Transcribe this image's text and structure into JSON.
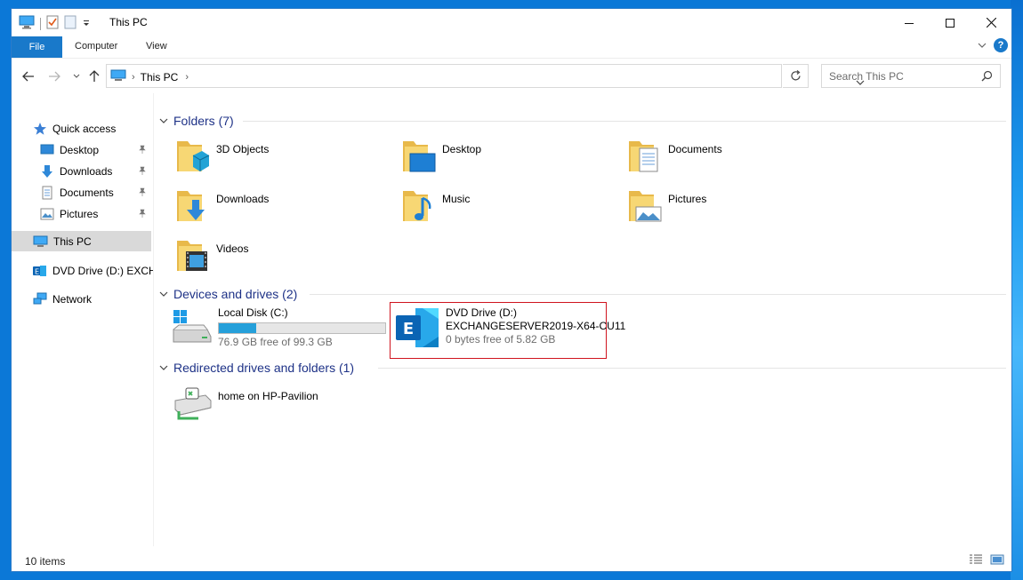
{
  "window": {
    "title": "This PC"
  },
  "ribbon": {
    "file_tab": "File",
    "tabs": [
      "Computer",
      "View"
    ],
    "help": "?"
  },
  "address_bar": {
    "crumbs": [
      "This PC"
    ]
  },
  "search": {
    "placeholder": "Search This PC"
  },
  "sidebar": {
    "items": [
      {
        "label": "Quick access",
        "icon": "star-icon"
      },
      {
        "label": "Desktop",
        "icon": "desktop-icon",
        "pinned": true
      },
      {
        "label": "Downloads",
        "icon": "download-arrow-icon",
        "pinned": true
      },
      {
        "label": "Documents",
        "icon": "document-icon",
        "pinned": true
      },
      {
        "label": "Pictures",
        "icon": "picture-icon",
        "pinned": true
      },
      {
        "label": "This PC",
        "icon": "computer-icon",
        "selected": true
      },
      {
        "label": "DVD Drive (D:) EXCHA",
        "icon": "exchange-icon"
      },
      {
        "label": "Network",
        "icon": "network-icon"
      }
    ]
  },
  "groups": {
    "folders": {
      "header": "Folders (7)",
      "items": [
        "3D Objects",
        "Desktop",
        "Documents",
        "Downloads",
        "Music",
        "Pictures",
        "Videos"
      ]
    },
    "devices": {
      "header": "Devices and drives (2)",
      "local_disk": {
        "name": "Local Disk (C:)",
        "free_text": "76.9 GB free of 99.3 GB",
        "used_fraction": 0.226
      },
      "dvd": {
        "name": "DVD Drive (D:)",
        "label": "EXCHANGESERVER2019-X64-CU11",
        "free_text": "0 bytes free of 5.82 GB"
      }
    },
    "redirected": {
      "header": "Redirected drives and folders (1)",
      "items": [
        "home on HP-Pavilion"
      ]
    }
  },
  "status": {
    "item_count": "10 items"
  },
  "colors": {
    "accent": "#1979ca",
    "group_header": "#1e3287",
    "progress": "#26a0da",
    "highlight_box": "#d0141e"
  }
}
